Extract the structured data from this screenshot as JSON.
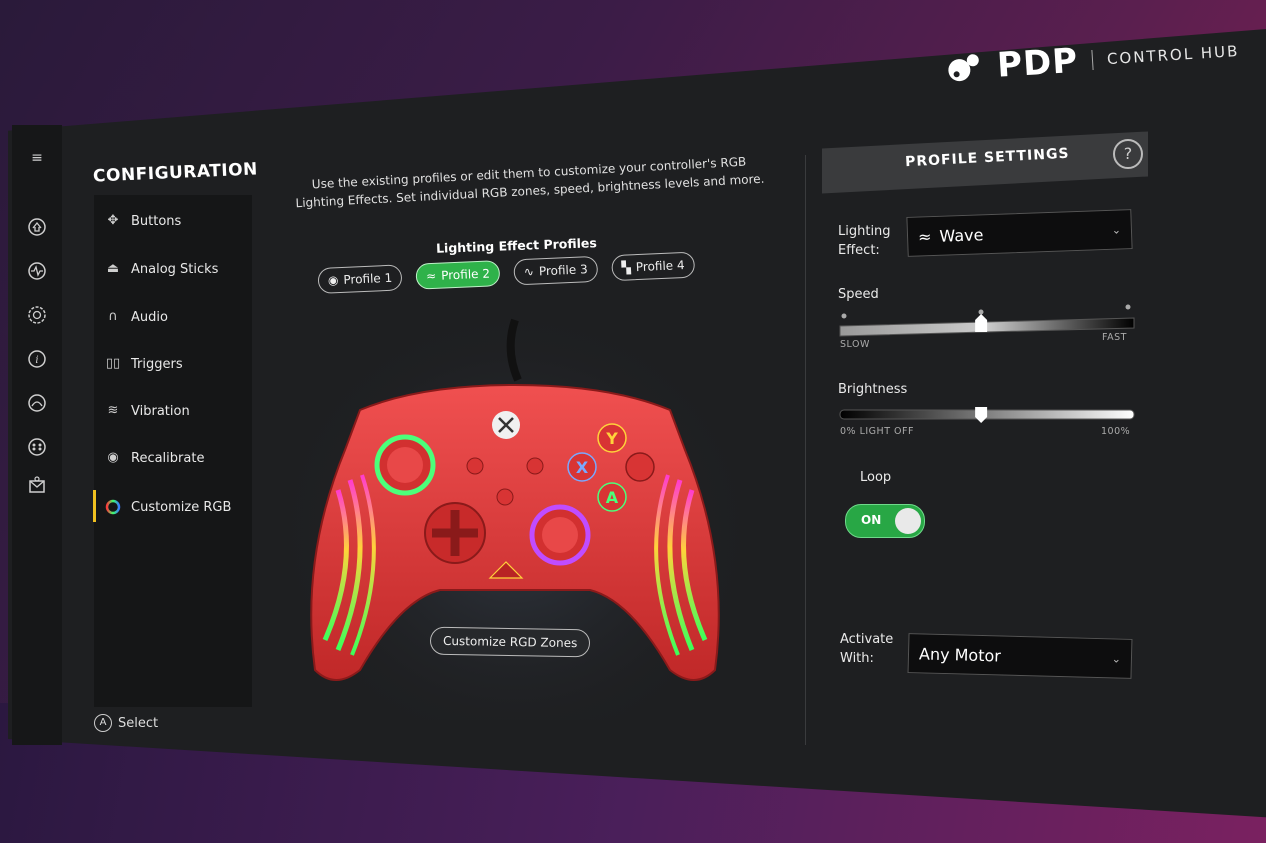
{
  "header": {
    "brand": "PDP",
    "hub_title": "CONTROL HUB"
  },
  "rail": {
    "icons": [
      "menu-icon",
      "home-icon",
      "activity-icon",
      "settings-icon",
      "info-icon",
      "controller-face-icon",
      "gamepad-icon",
      "mail-icon"
    ]
  },
  "configuration": {
    "title": "CONFIGURATION",
    "items": [
      {
        "label": "Buttons",
        "icon": "buttons-icon"
      },
      {
        "label": "Analog Sticks",
        "icon": "analog-stick-icon"
      },
      {
        "label": "Audio",
        "icon": "headset-icon"
      },
      {
        "label": "Triggers",
        "icon": "triggers-icon"
      },
      {
        "label": "Vibration",
        "icon": "vibration-icon"
      },
      {
        "label": "Recalibrate",
        "icon": "recalibrate-icon"
      },
      {
        "label": "Customize RGB",
        "icon": "rgb-icon",
        "active": true
      }
    ],
    "select_hint": {
      "button": "A",
      "label": "Select"
    }
  },
  "main": {
    "description": "Use the existing profiles or edit them to customize your controller's RGB Lighting Effects. Set individual RGB zones, speed, brightness levels and more.",
    "profiles_title": "Lighting Effect Profiles",
    "profiles": [
      {
        "label": "Profile 1",
        "icon": "dot-circle-icon",
        "active": false
      },
      {
        "label": "Profile 2",
        "icon": "wave-icon",
        "active": true
      },
      {
        "label": "Profile 3",
        "icon": "pulse-icon",
        "active": false
      },
      {
        "label": "Profile 4",
        "icon": "blocks-icon",
        "active": false
      }
    ],
    "controller_buttons": {
      "y": "Y",
      "x": "X",
      "a": "A"
    },
    "customize_zones_label": "Customize RGD Zones"
  },
  "profile_settings": {
    "title": "PROFILE SETTINGS",
    "lighting_effect": {
      "label_line1": "Lighting",
      "label_line2": "Effect:",
      "value": "Wave",
      "icon": "wave-icon"
    },
    "speed": {
      "label": "Speed",
      "min_label": "SLOW",
      "max_label": "FAST",
      "value": 0.48
    },
    "brightness": {
      "label": "Brightness",
      "min_label": "0% LIGHT OFF",
      "max_label": "100%",
      "value": 0.48
    },
    "loop": {
      "label": "Loop",
      "state_label": "ON",
      "on": true
    },
    "activate_with": {
      "label_line1": "Activate",
      "label_line2": "With:",
      "value": "Any Motor"
    }
  },
  "colors": {
    "accent_green": "#2fb24a",
    "active_bar": "#f0c020",
    "controller_red": "#e23a3a"
  }
}
